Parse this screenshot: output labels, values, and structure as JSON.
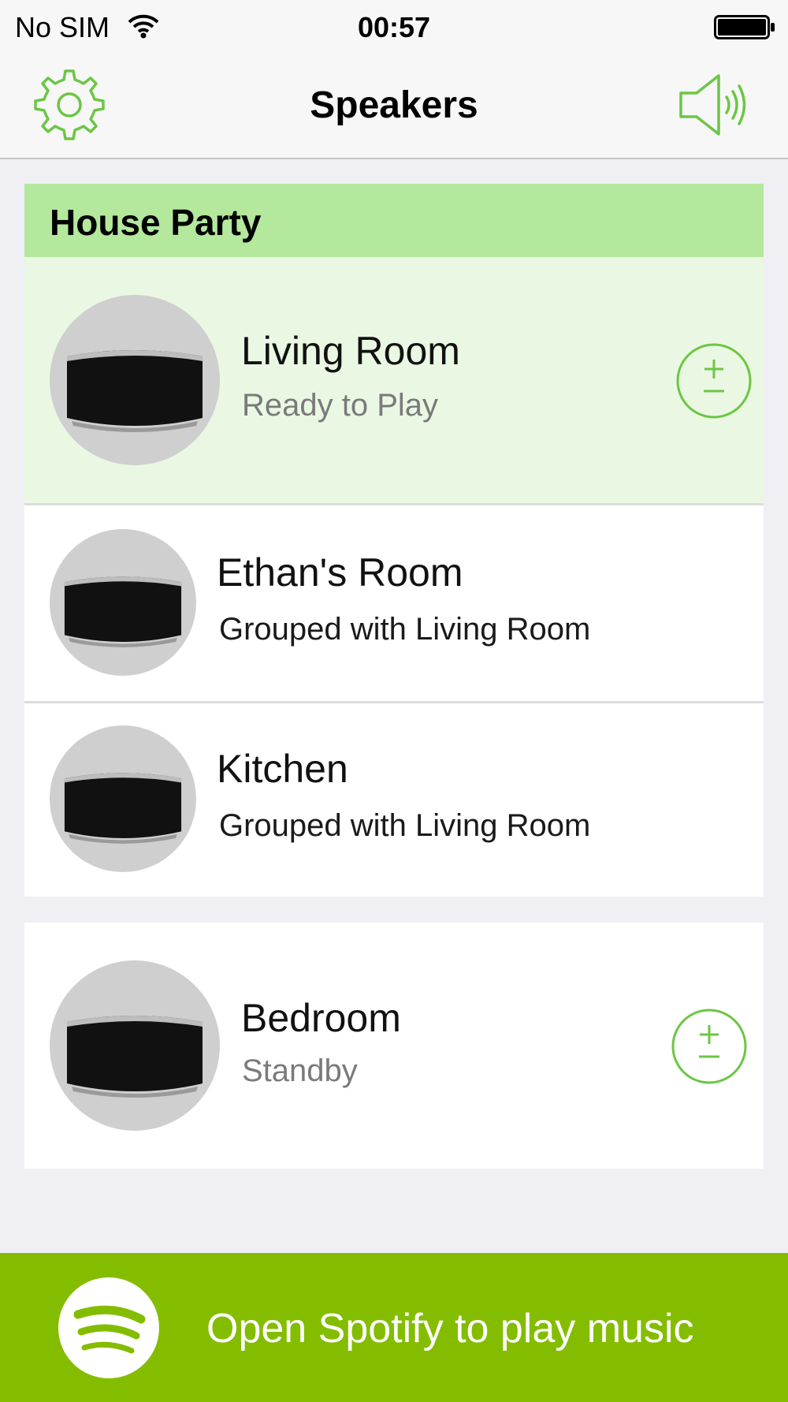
{
  "status_bar": {
    "carrier": "No SIM",
    "time": "00:57"
  },
  "nav": {
    "title": "Speakers",
    "settings_icon": "gear-icon",
    "volume_icon": "speaker-volume-icon"
  },
  "colors": {
    "accent_green": "#6cc644",
    "group_header": "#b4e89d",
    "active_row": "#eaf8e3",
    "spotify_green": "#84bd00"
  },
  "group": {
    "title": "House Party",
    "speakers": [
      {
        "name": "Living Room",
        "status": "Ready to Play"
      },
      {
        "name": "Ethan's Room",
        "status": "Grouped with Living Room"
      },
      {
        "name": "Kitchen",
        "status": "Grouped with Living Room"
      }
    ]
  },
  "standalone": {
    "speakers": [
      {
        "name": "Bedroom",
        "status": "Standby"
      }
    ]
  },
  "footer": {
    "spotify_label": "Open Spotify to play music",
    "spotify_icon": "spotify-logo-icon"
  }
}
